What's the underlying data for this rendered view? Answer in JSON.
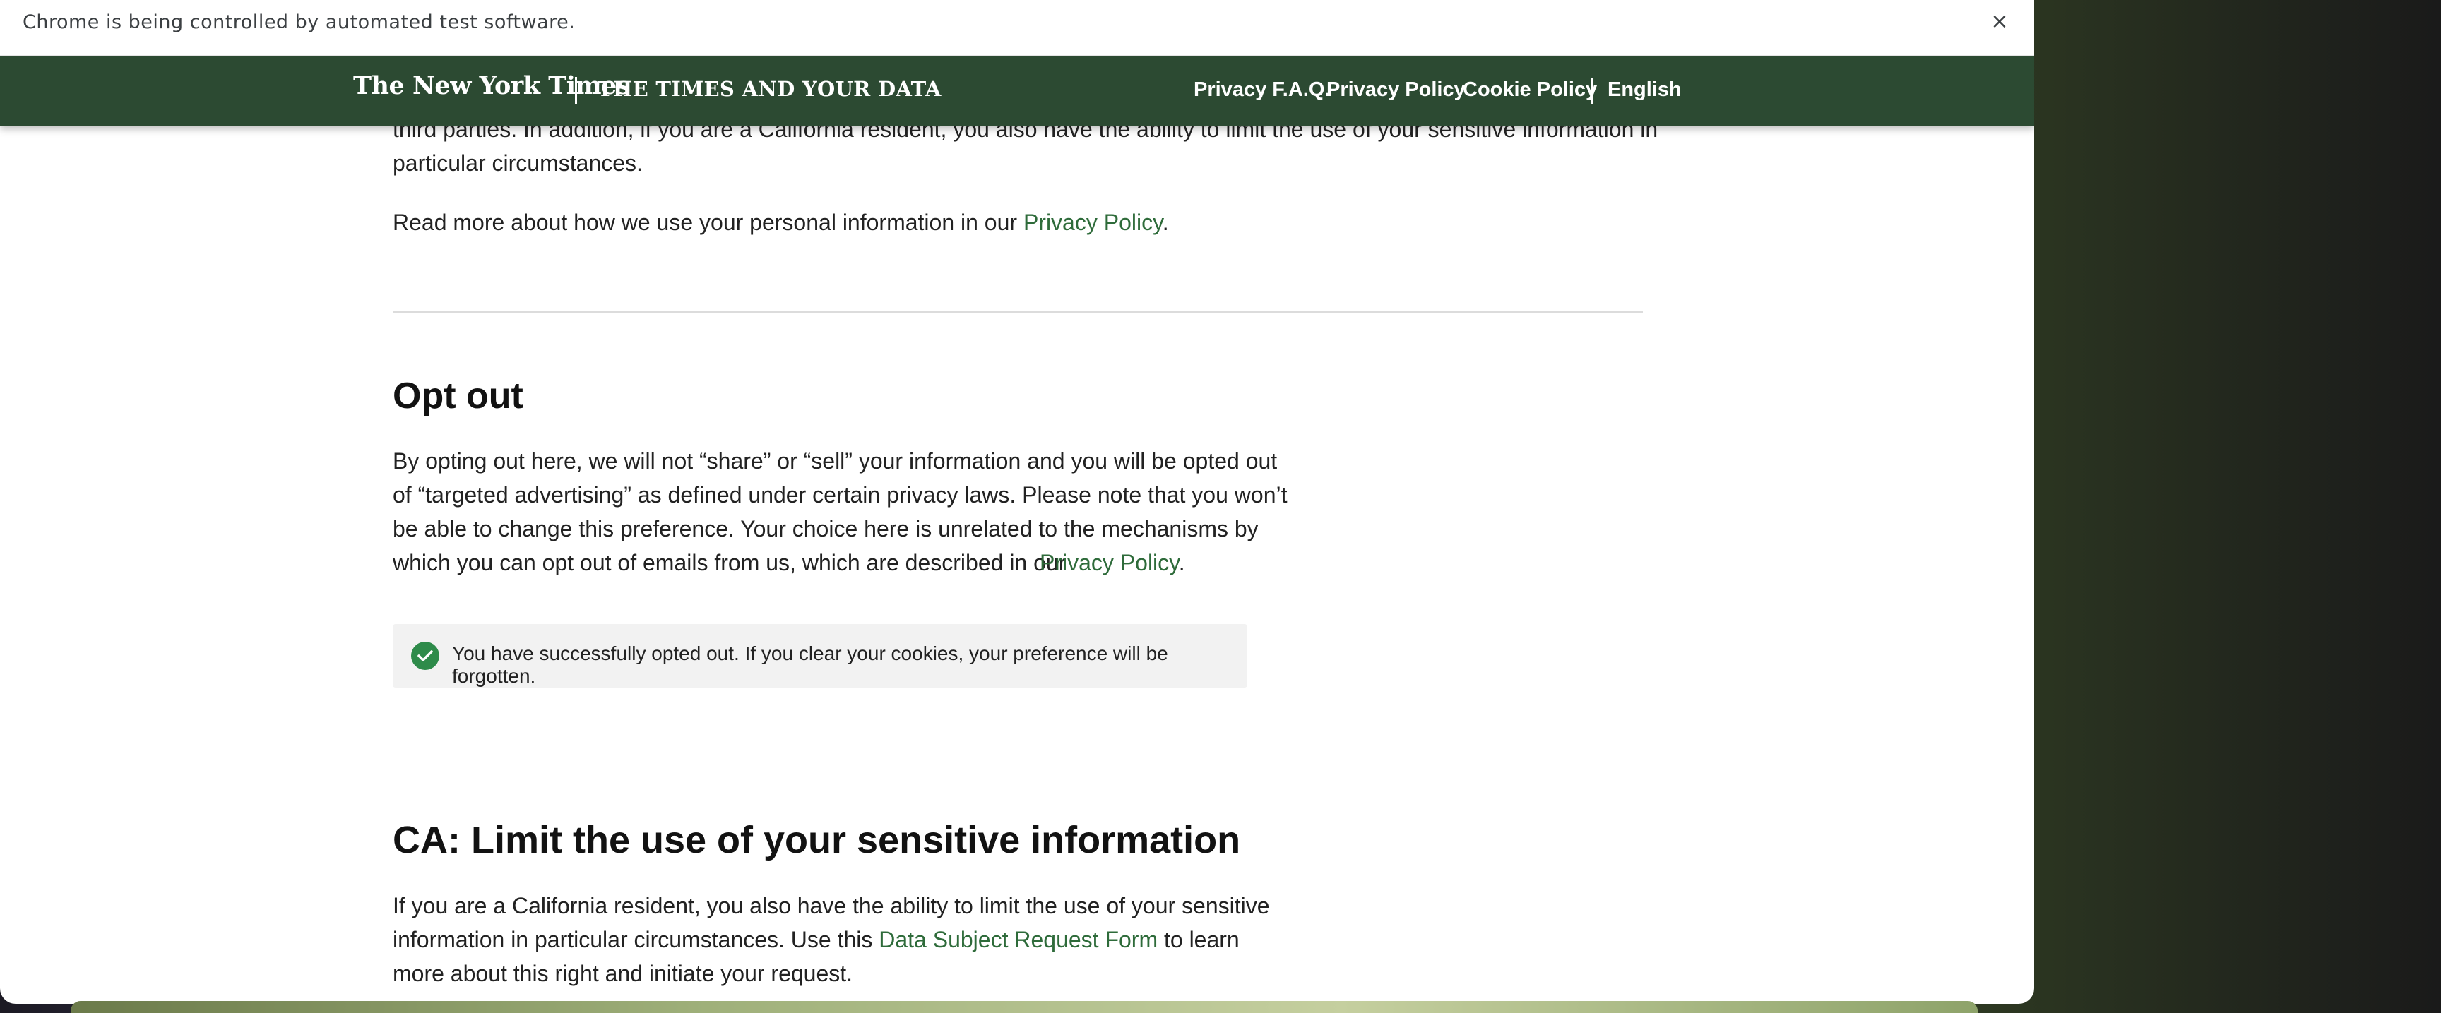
{
  "browser": {
    "infobar_text": "Chrome is being controlled by automated test software.",
    "close_glyph": "×"
  },
  "header": {
    "logo": "The New York Times",
    "section": "THE TIMES AND YOUR DATA",
    "nav": [
      {
        "label": "Privacy F.A.Q."
      },
      {
        "label": "Privacy Policy"
      },
      {
        "label": "Cookie Policy"
      },
      {
        "label": "English"
      }
    ],
    "bg_color": "#2c4a32"
  },
  "intro": {
    "line1": "third parties. In addition, if you are a California resident, you also have the ability to limit the use of your sensitive information in",
    "line2": "particular circumstances.",
    "read_more_prefix": "Read more about how we use your personal information in our",
    "read_more_link": "Privacy Policy",
    "period": "."
  },
  "opt_out": {
    "heading": "Opt out",
    "lines": [
      "By opting out here, we will not “share” or “sell” your information and you will be opted out",
      "of “targeted advertising” as defined under certain privacy laws. Please note that you won’t",
      "be able to change this preference. Your choice here is unrelated to the mechanisms by",
      "which you can opt out of emails from us, which are described in our"
    ],
    "link": "Privacy Policy",
    "period": ".",
    "alert": "You have successfully opted out. If you clear your cookies, your preference will be forgotten.",
    "alert_color": "#2e8b4a"
  },
  "ca_limit": {
    "heading": "CA: Limit the use of your sensitive information",
    "line1": "If you are a California resident, you also have the ability to limit the use of your sensitive",
    "line2_prefix": "information in particular circumstances. Use this",
    "line2_link": "Data Subject Request Form",
    "line2_suffix": "to learn",
    "line3": "more about this right and initiate your request."
  },
  "colors": {
    "link": "#2e6b3a",
    "text": "#222222"
  }
}
